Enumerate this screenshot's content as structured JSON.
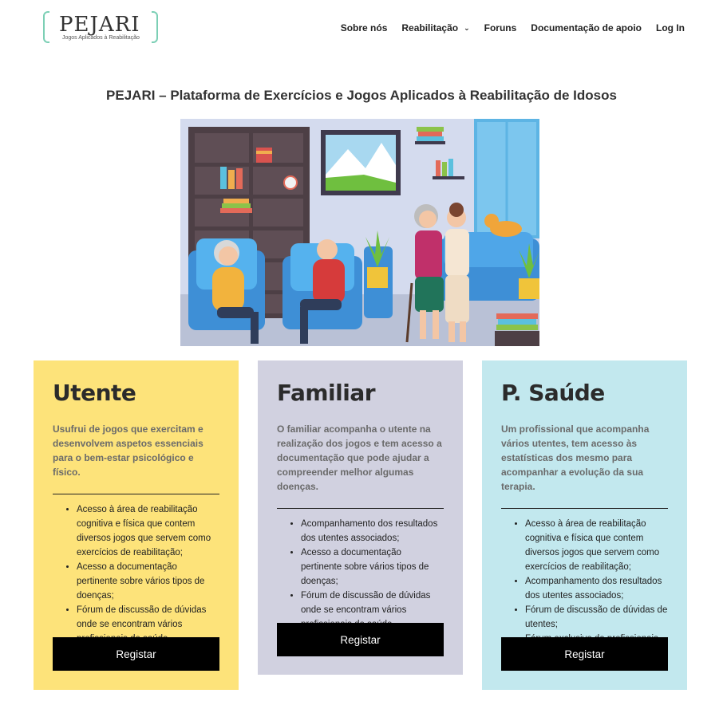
{
  "logo": {
    "title": "PEJARI",
    "subtitle": "Jogos Aplicados à Reabilitação"
  },
  "nav": {
    "items": [
      "Sobre nós",
      "Reabilitação",
      "Foruns",
      "Documentação de apoio",
      "Log In"
    ]
  },
  "page": {
    "title": "PEJARI – Plataforma de Exercícios e Jogos Aplicados à Reabilitação de Idosos"
  },
  "cards": [
    {
      "title": "Utente",
      "description": "Usufrui de jogos que exercitam e desenvolvem aspetos essenciais para o bem-estar psicológico e físico.",
      "items": [
        "Acesso à área de reabilitação cognitiva e física que contem diversos jogos que servem como exercícios de reabilitação;",
        "Acesso a documentação pertinente sobre vários tipos de doenças;",
        "Fórum de discussão de dúvidas onde se encontram vários profissionais de saúde."
      ],
      "button": "Registar",
      "color": "#fde37a"
    },
    {
      "title": "Familiar",
      "description": "O familiar acompanha o utente na realização dos jogos e tem acesso a documentação que pode ajudar a compreender melhor algumas doenças.",
      "items": [
        "Acompanhamento dos resultados dos utentes associados;",
        "Acesso a documentação pertinente sobre vários tipos de doenças;",
        "Fórum de discussão de dúvidas onde se encontram vários profissionais de saúde."
      ],
      "button": "Registar",
      "color": "#d1d1e0"
    },
    {
      "title": "P. Saúde",
      "description": "Um profissional que acompanha vários utentes, tem acesso às estatísticas dos mesmo para acompanhar a evolução da sua terapia.",
      "items": [
        "Acesso à área de reabilitação cognitiva e física que contem diversos jogos que servem como exercícios de reabilitação;",
        "Acompanhamento dos resultados dos utentes associados;",
        "Fórum de discussão de dúvidas de utentes;",
        "Fórum exclusivo de profissionais."
      ],
      "button": "Registar",
      "color": "#c2e8ee"
    }
  ]
}
